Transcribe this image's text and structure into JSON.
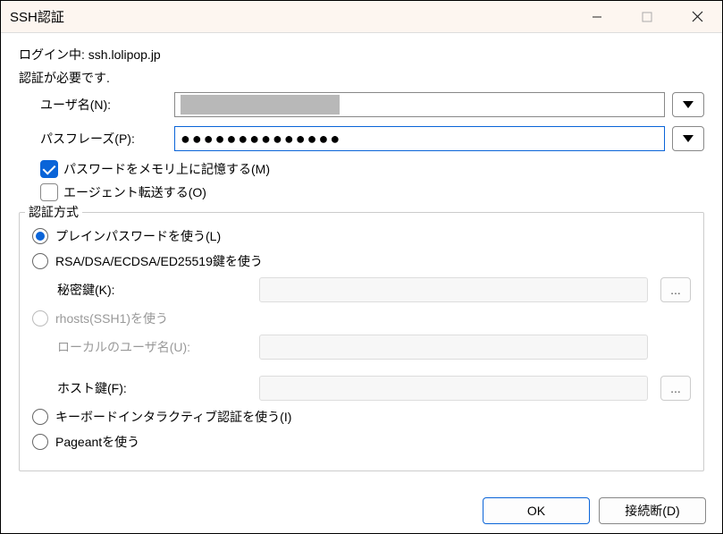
{
  "titlebar": {
    "title": "SSH認証"
  },
  "login": {
    "prefix": "ログイン中:",
    "host": "ssh.lolipop.jp",
    "need_auth": "認証が必要です."
  },
  "form": {
    "username_label": "ユーザ名(N):",
    "username_value": "",
    "passphrase_label": "パスフレーズ(P):",
    "passphrase_value": "●●●●●●●●●●●●●●",
    "remember_label": "パスワードをメモリ上に記憶する(M)",
    "agent_forward_label": "エージェント転送する(O)"
  },
  "auth": {
    "legend": "認証方式",
    "plain_label": "プレインパスワードを使う(L)",
    "rsa_label": "RSA/DSA/ECDSA/ED25519鍵を使う",
    "private_key_label": "秘密鍵(K):",
    "rhosts_label": "rhosts(SSH1)を使う",
    "local_user_label": "ローカルのユーザ名(U):",
    "host_key_label": "ホスト鍵(F):",
    "keyboard_label": "キーボードインタラクティブ認証を使う(I)",
    "pageant_label": "Pageantを使う",
    "browse": "..."
  },
  "buttons": {
    "ok": "OK",
    "disconnect": "接続断(D)"
  }
}
